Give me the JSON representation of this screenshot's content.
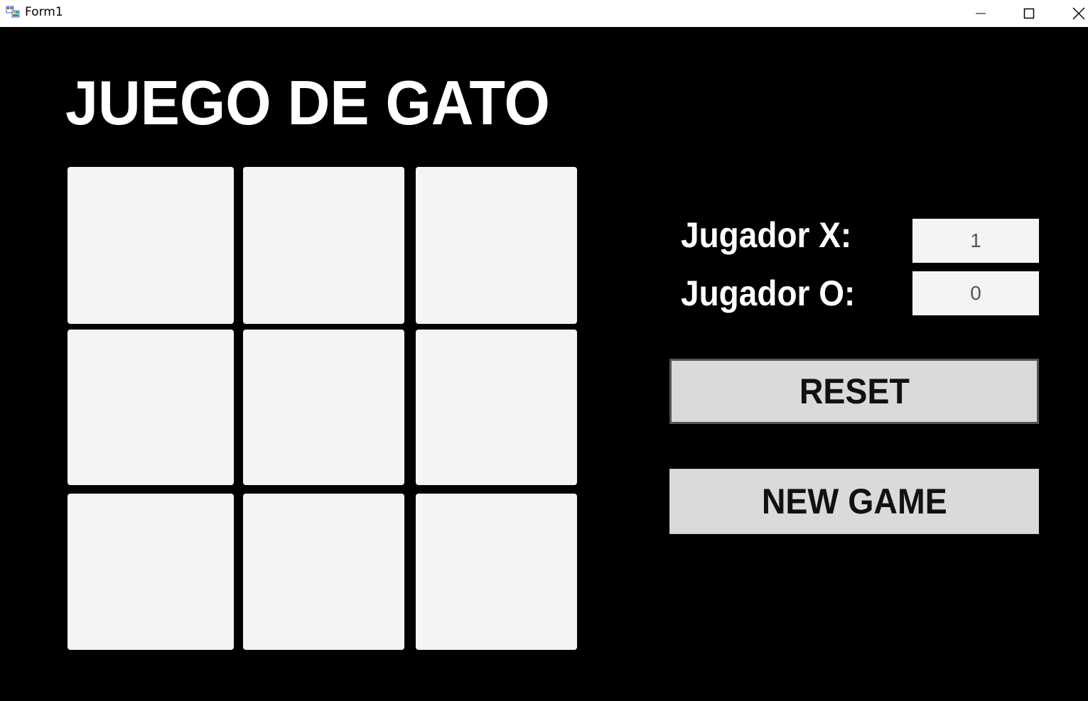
{
  "window": {
    "title": "Form1",
    "icon": "winforms-app-icon",
    "controls": [
      "minimize-icon",
      "maximize-icon",
      "close-icon"
    ]
  },
  "game": {
    "title": "JUEGO DE GATO",
    "board": [
      "",
      "",
      "",
      "",
      "",
      "",
      "",
      "",
      ""
    ]
  },
  "scores": {
    "x_label": "Jugador X:",
    "x_value": "1",
    "o_label": "Jugador O:",
    "o_value": "0"
  },
  "buttons": {
    "reset": "RESET",
    "new_game": "NEW GAME"
  },
  "colors": {
    "background": "#000000",
    "cell": "#f4f4f4",
    "button": "#dadada",
    "text_light": "#ffffff"
  }
}
